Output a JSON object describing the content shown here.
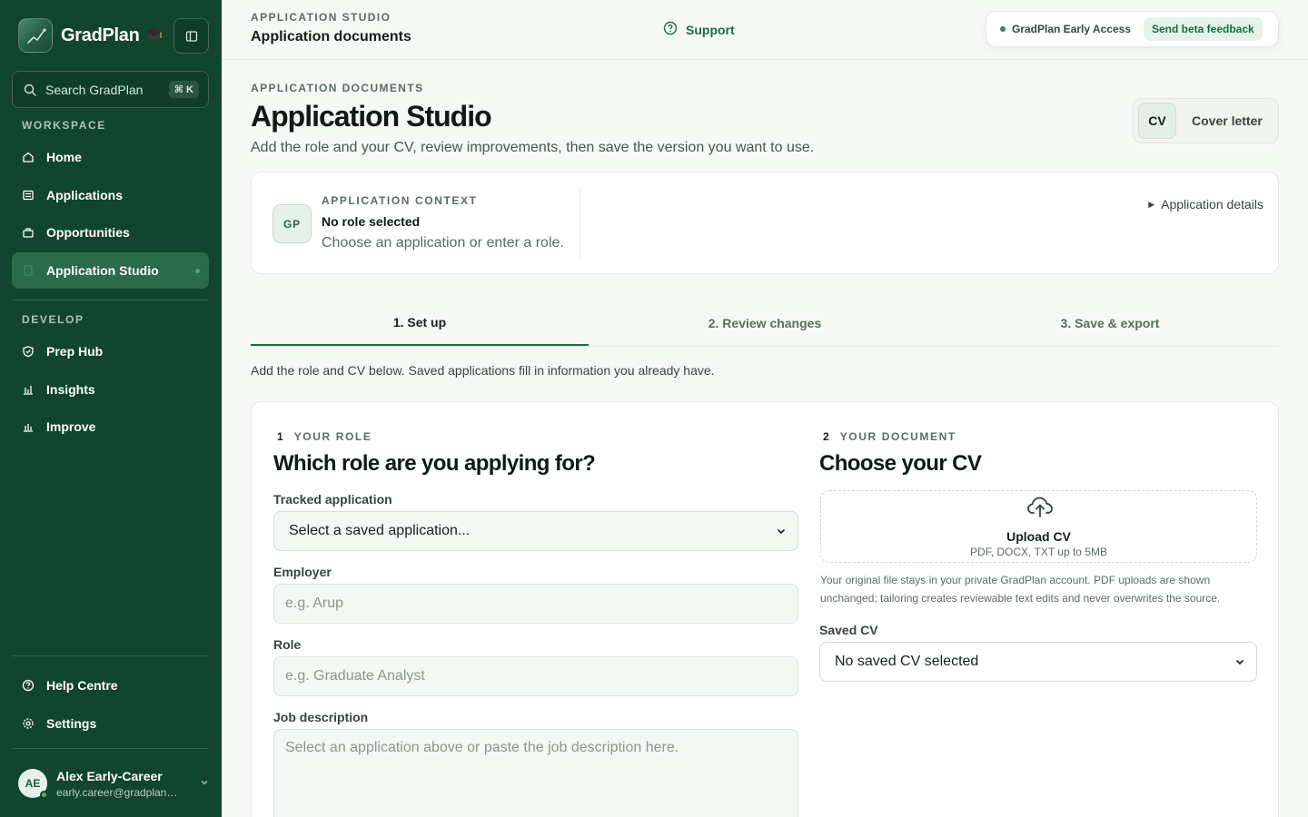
{
  "app": {
    "name": "GradPlan",
    "search_placeholder": "Search GradPlan",
    "search_shortcut": "⌘ K"
  },
  "sidebar": {
    "workspace_label": "WORKSPACE",
    "workspace_items": [
      {
        "label": "Home",
        "icon": "home-icon"
      },
      {
        "label": "Applications",
        "icon": "applications-icon"
      },
      {
        "label": "Opportunities",
        "icon": "briefcase-icon"
      },
      {
        "label": "Application Studio",
        "icon": "document-icon",
        "active": true
      }
    ],
    "develop_label": "DEVELOP",
    "develop_items": [
      {
        "label": "Prep Hub",
        "icon": "shield-icon"
      },
      {
        "label": "Insights",
        "icon": "bar-chart-icon"
      },
      {
        "label": "Improve",
        "icon": "bar-chart-icon"
      }
    ],
    "footer_items": [
      {
        "label": "Help Centre",
        "icon": "help-icon"
      },
      {
        "label": "Settings",
        "icon": "gear-icon"
      }
    ],
    "user": {
      "initials": "AE",
      "name": "Alex Early-Career",
      "email": "early.career@gradplan.com"
    }
  },
  "topbar": {
    "eyebrow": "APPLICATION STUDIO",
    "title": "Application documents",
    "support_label": "Support",
    "beta_label": "GradPlan Early Access",
    "beta_button": "Send beta feedback"
  },
  "main": {
    "eyebrow": "APPLICATION DOCUMENTS",
    "title": "Application Studio",
    "subtitle": "Add the role and your CV, review improvements, then save the version you want to use.",
    "doc_toggle": {
      "cv": "CV",
      "cover_letter": "Cover letter"
    }
  },
  "context": {
    "badge": "GP",
    "eyebrow": "APPLICATION CONTEXT",
    "title": "No role selected",
    "subtitle": "Choose an application or enter a role.",
    "details_label": "Application details"
  },
  "steps": {
    "items": [
      "1. Set up",
      "2. Review changes",
      "3. Save & export"
    ],
    "active_index": 0,
    "note": "Add the role and CV below. Saved applications fill in information you already have."
  },
  "role_section": {
    "number": "1",
    "eyebrow": "YOUR ROLE",
    "title": "Which role are you applying for?",
    "tracked_label": "Tracked application",
    "tracked_value": "Select a saved application...",
    "employer_label": "Employer",
    "employer_placeholder": "e.g. Arup",
    "role_label": "Role",
    "role_placeholder": "e.g. Graduate Analyst",
    "jd_label": "Job description",
    "jd_placeholder": "Select an application above or paste the job description here."
  },
  "document_section": {
    "number": "2",
    "eyebrow": "YOUR DOCUMENT",
    "title": "Choose your CV",
    "upload_title": "Upload CV",
    "upload_sub": "PDF, DOCX, TXT up to 5MB",
    "upload_note": "Your original file stays in your private GradPlan account. PDF uploads are shown unchanged; tailoring creates reviewable text edits and never overwrites the source.",
    "saved_label": "Saved CV",
    "saved_value": "No saved CV selected"
  },
  "colors": {
    "sidebar_bg": "#12452f",
    "accent": "#1d6a45",
    "active_nav": "#2b6a4a"
  }
}
